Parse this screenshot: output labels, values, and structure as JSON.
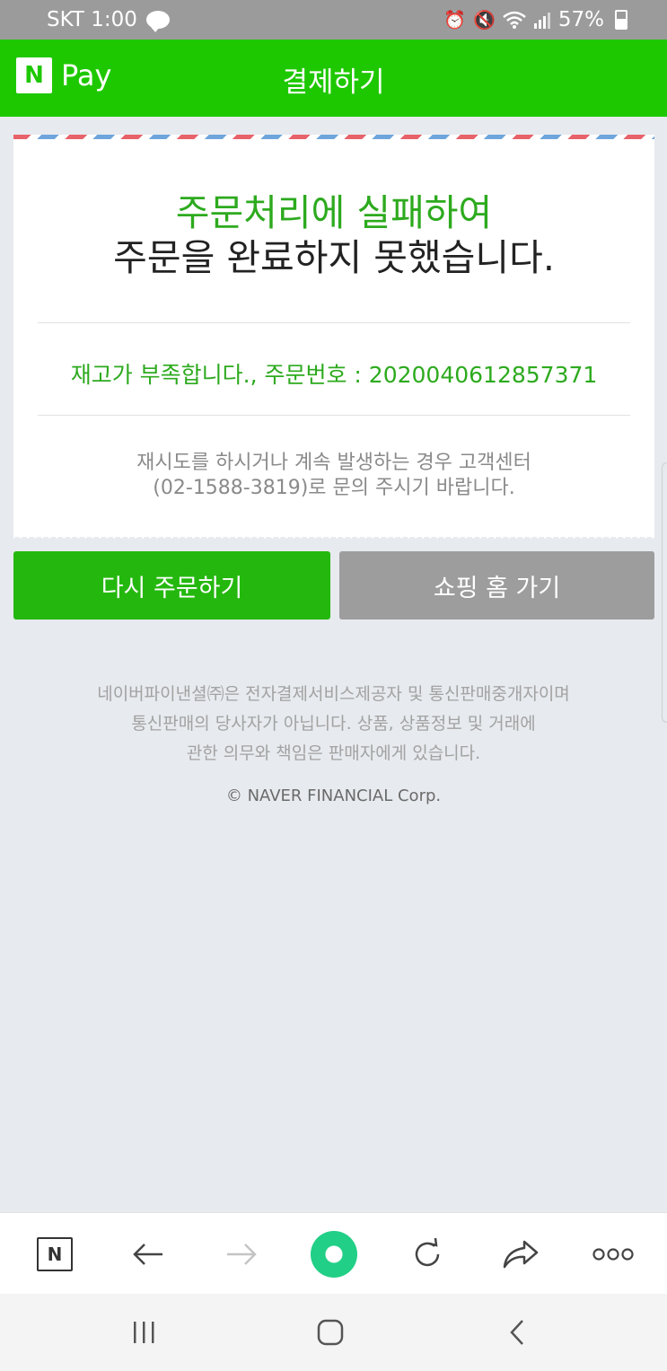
{
  "status_bar": {
    "carrier_time": "SKT 1:00",
    "talk_badge": "TALK",
    "battery": "57%"
  },
  "header": {
    "logo_letter": "N",
    "logo_text": "Pay",
    "title": "결제하기"
  },
  "result": {
    "headline_line1": "주문처리에 실패하여",
    "headline_line2": "주문을 완료하지 못했습니다.",
    "reason": "재고가 부족합니다., 주문번호 : 2020040612857371",
    "notice_line1": "재시도를 하시거나 계속 발생하는 경우 고객센터",
    "notice_line2": "(02-1588-3819)로 문의 주시기 바랍니다."
  },
  "buttons": {
    "retry": "다시 주문하기",
    "shopping_home": "쇼핑 홈 가기"
  },
  "footer": {
    "line1": "네이버파이낸셜㈜은 전자결제서비스제공자 및 통신판매중개자이며",
    "line2": "통신판매의 당사자가 아닙니다. 상품, 상품정보 및 거래에",
    "line3": "관한 의무와 책임은 판매자에게 있습니다.",
    "copyright": "© NAVER FINANCIAL Corp."
  },
  "toolbar": {
    "naver_letter": "N",
    "icons": [
      "naver-icon",
      "back-arrow-icon",
      "forward-arrow-icon",
      "green-dot-icon",
      "reload-icon",
      "share-icon",
      "more-icon"
    ]
  },
  "colors": {
    "brand_green": "#1ec800",
    "success_text_green": "#2daa1e",
    "retry_button": "#24b80e",
    "home_button": "#9d9d9d",
    "green_dot": "#21cf86"
  }
}
